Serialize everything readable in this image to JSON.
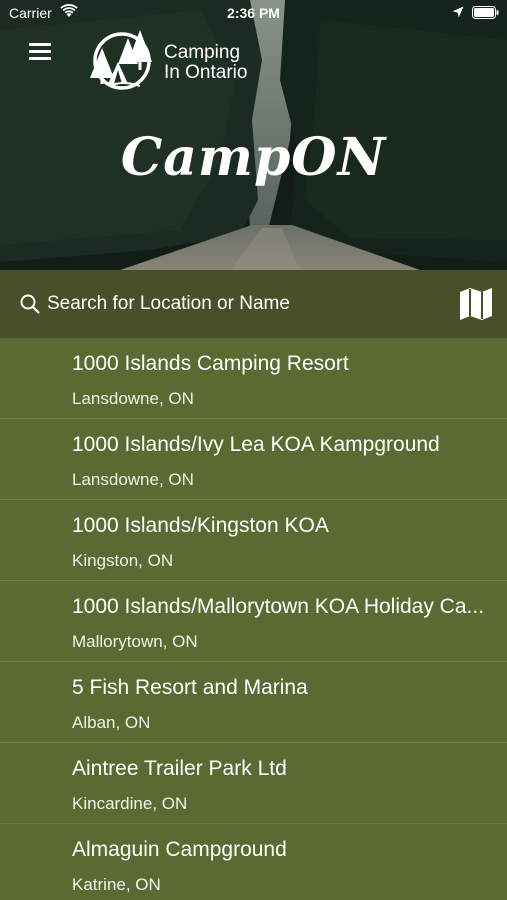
{
  "status_bar": {
    "carrier": "Carrier",
    "time": "2:36 PM"
  },
  "header": {
    "logo_line1": "Camping",
    "logo_line2": "In Ontario",
    "app_title": "CampON"
  },
  "search": {
    "placeholder": "Search for Location or Name"
  },
  "campgrounds": [
    {
      "name": "1000 Islands Camping Resort",
      "location": "Lansdowne, ON"
    },
    {
      "name": "1000 Islands/Ivy Lea KOA Kampground",
      "location": "Lansdowne, ON"
    },
    {
      "name": "1000 Islands/Kingston KOA",
      "location": "Kingston, ON"
    },
    {
      "name": "1000 Islands/Mallorytown KOA Holiday Ca...",
      "location": "Mallorytown, ON"
    },
    {
      "name": "5 Fish Resort and Marina",
      "location": "Alban, ON"
    },
    {
      "name": "Aintree Trailer Park Ltd",
      "location": "Kincardine, ON"
    },
    {
      "name": "Almaguin Campground",
      "location": "Katrine, ON"
    }
  ],
  "icons": {
    "menu": "hamburger-menu-icon",
    "search": "search-icon",
    "map": "map-icon",
    "wifi": "wifi-icon",
    "location": "location-arrow-icon",
    "battery": "battery-icon"
  },
  "colors": {
    "list_background": "#5b6a33",
    "search_background": "#46512a",
    "text": "#ffffff"
  }
}
